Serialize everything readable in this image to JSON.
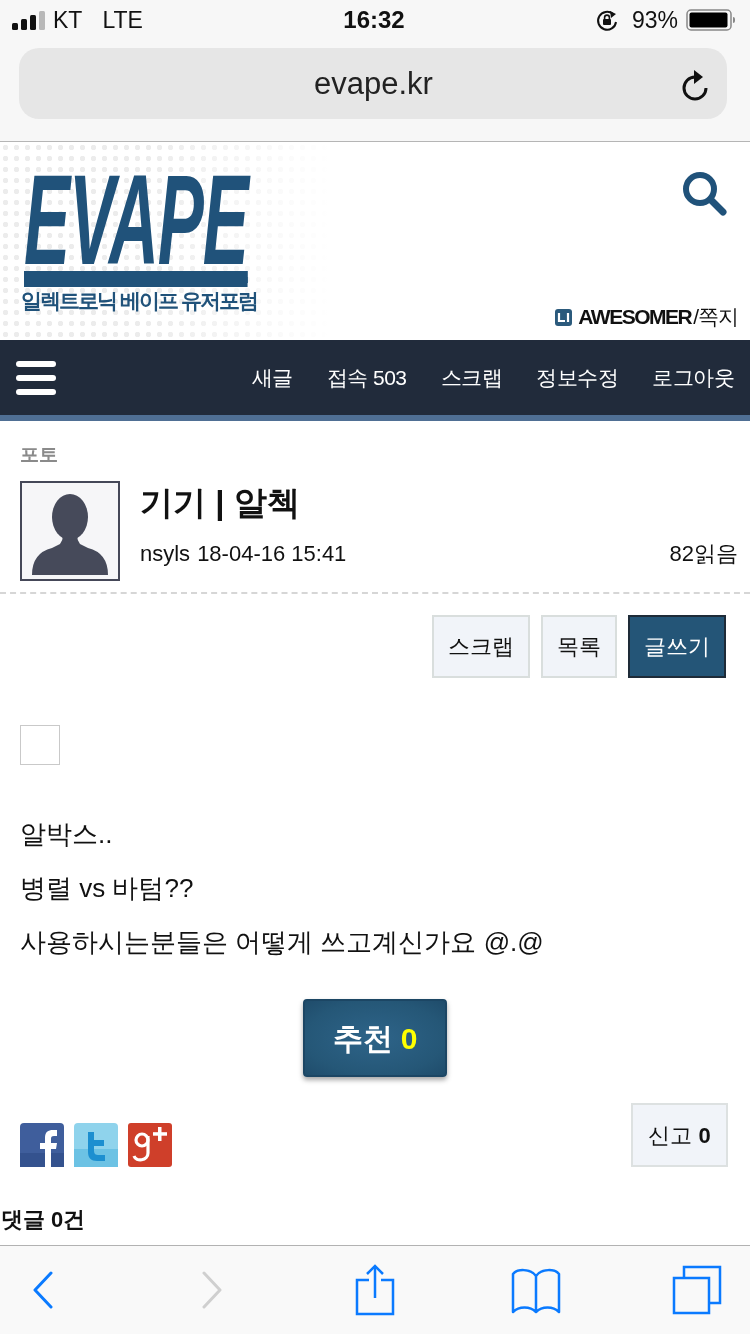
{
  "status_bar": {
    "carrier": "KT",
    "network": "LTE",
    "time": "16:32",
    "battery": "93%"
  },
  "address_bar": {
    "url": "evape.kr"
  },
  "site_header": {
    "logo": "EVAPE",
    "tagline": "일렉트로닉 베이프 유저포럼",
    "username": "AWESOMER",
    "messages_link": "/쪽지"
  },
  "nav": {
    "items": [
      "새글",
      "접속 503",
      "스크랩",
      "정보수정",
      "로그아웃"
    ]
  },
  "post": {
    "category": "포토",
    "title": "기기 | 알첵",
    "author": "nsyls",
    "date": "18-04-16 15:41",
    "views": "82읽음",
    "actions": [
      {
        "label": "스크랩",
        "kind": "default"
      },
      {
        "label": "목록",
        "kind": "default"
      },
      {
        "label": "글쓰기",
        "kind": "primary"
      }
    ],
    "media": [
      {
        "kind": "image"
      }
    ],
    "body": [
      "알박스..",
      "병렬 vs 바텀??",
      "사용하시는분들은 어떻게 쓰고계신가요 @.@"
    ],
    "recommend": {
      "label": "추천",
      "count": "0"
    },
    "share": [
      {
        "kind": "facebook"
      },
      {
        "kind": "twitter"
      },
      {
        "kind": "google_plus"
      }
    ],
    "report": {
      "label": "신고",
      "count": "0"
    }
  },
  "comments": {
    "heading": "댓글 0건"
  },
  "browser_toolbar": {
    "buttons": [
      {
        "kind": "back",
        "disabled": false
      },
      {
        "kind": "forward",
        "disabled": true
      },
      {
        "kind": "share",
        "disabled": false
      },
      {
        "kind": "bookmarks",
        "disabled": false
      },
      {
        "kind": "tabs",
        "disabled": false
      }
    ]
  }
}
